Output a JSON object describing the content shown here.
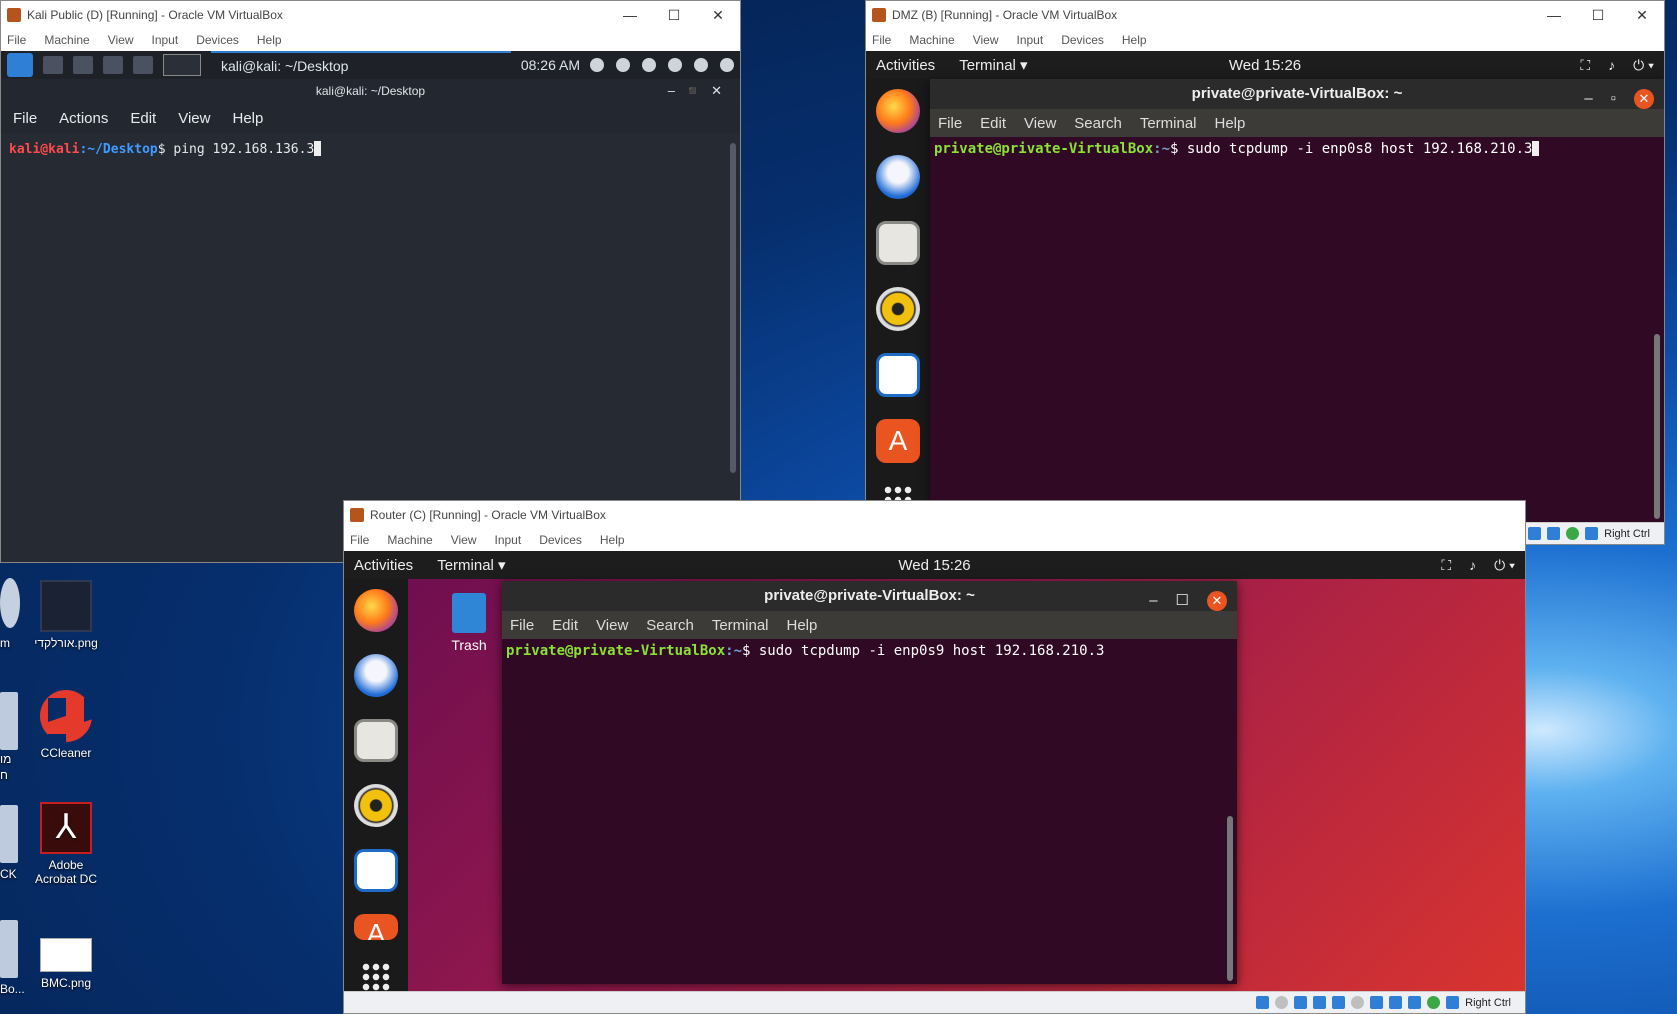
{
  "desktop": {
    "icons": [
      {
        "label": "אורלקדי.png"
      },
      {
        "label": "CCleaner"
      },
      {
        "label": "Adobe Acrobat DC"
      },
      {
        "label": "BMC.png"
      }
    ],
    "edge_labels": [
      "m",
      "מו",
      "ח",
      "CK",
      "Bo..."
    ]
  },
  "kali_window": {
    "title": "Kali Public (D) [Running] - Oracle VM VirtualBox",
    "menu": [
      "File",
      "Machine",
      "View",
      "Input",
      "Devices",
      "Help"
    ],
    "taskbar": {
      "task": "kali@kali: ~/Desktop",
      "time": "08:26 AM"
    },
    "terminal": {
      "title": "kali@kali: ~/Desktop",
      "menu": [
        "File",
        "Actions",
        "Edit",
        "View",
        "Help"
      ],
      "user": "kali@kali",
      "path": ":~/Desktop",
      "prompt_end": "$ ",
      "command": "ping 192.168.136.3"
    }
  },
  "dmz_window": {
    "title": "DMZ (B) [Running] - Oracle VM VirtualBox",
    "menu": [
      "File",
      "Machine",
      "View",
      "Input",
      "Devices",
      "Help"
    ],
    "topbar": {
      "activities": "Activities",
      "app": "Terminal ▾",
      "clock": "Wed 15:26"
    },
    "terminal": {
      "title": "private@private-VirtualBox: ~",
      "menu": [
        "File",
        "Edit",
        "View",
        "Search",
        "Terminal",
        "Help"
      ],
      "user": "private@private-VirtualBox",
      "path": ":~",
      "prompt_end": "$ ",
      "command": "sudo tcpdump -i enp0s8 host 192.168.210.3"
    },
    "status_right": "Right Ctrl"
  },
  "router_window": {
    "title": "Router (C) [Running] - Oracle VM VirtualBox",
    "menu": [
      "File",
      "Machine",
      "View",
      "Input",
      "Devices",
      "Help"
    ],
    "topbar": {
      "activities": "Activities",
      "app": "Terminal ▾",
      "clock": "Wed 15:26"
    },
    "trash_label": "Trash",
    "terminal": {
      "title": "private@private-VirtualBox: ~",
      "menu": [
        "File",
        "Edit",
        "View",
        "Search",
        "Terminal",
        "Help"
      ],
      "user": "private@private-VirtualBox",
      "path": ":~",
      "prompt_end": "$ ",
      "command": "sudo tcpdump -i enp0s9 host 192.168.210.3"
    },
    "status_right": "Right Ctrl"
  }
}
